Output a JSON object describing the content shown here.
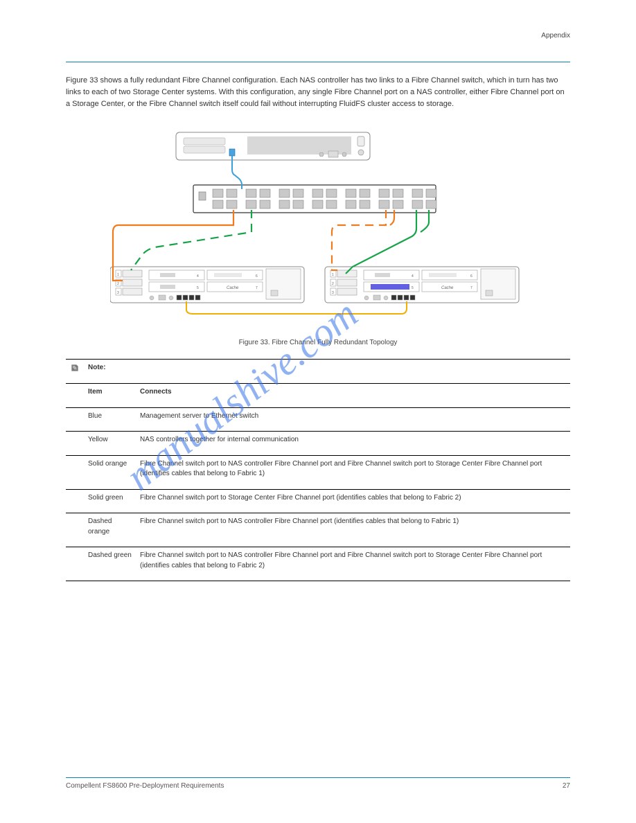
{
  "header": {
    "label": "Appendix"
  },
  "intro": "Figure 33 shows a fully redundant Fibre Channel configuration. Each NAS controller has two links to a Fibre Channel switch, which in turn has two links to each of two Storage Center systems. With this configuration, any single Fibre Channel port on a NAS controller, either Fibre Channel port on a Storage Center, or the Fibre Channel switch itself could fail without interrupting FluidFS cluster access to storage.",
  "diagram": {
    "server_label": "",
    "switch_label": "",
    "controllerA_cache": "Cache",
    "controllerB_cache": "Cache",
    "slot_labels": [
      "1",
      "2",
      "3",
      "4",
      "5",
      "6",
      "7"
    ]
  },
  "caption": "Figure 33. Fibre Channel Fully Redundant Topology",
  "table": {
    "note_label": "Note:",
    "note_text": "",
    "rows": [
      {
        "item": "Blue",
        "connects": "Management server to Ethernet switch"
      },
      {
        "item": "Yellow",
        "connects": "NAS controllers together for internal communication"
      },
      {
        "item": "Solid orange",
        "connects": "Fibre Channel switch port to NAS controller Fibre Channel port and Fibre Channel switch port to Storage Center Fibre Channel port (identifies cables that belong to Fabric 1)"
      },
      {
        "item": "Solid green",
        "connects": "Fibre Channel switch port to Storage Center Fibre Channel port (identifies cables that belong to Fabric 2)"
      },
      {
        "item": "Dashed orange",
        "connects": "Fibre Channel switch port to NAS controller Fibre Channel port (identifies cables that belong to Fabric 1)"
      },
      {
        "item": "Dashed green",
        "connects": "Fibre Channel switch port to NAS controller Fibre Channel port and Fibre Channel switch port to Storage Center Fibre Channel port (identifies cables that belong to Fabric 2)"
      }
    ]
  },
  "columns": {
    "item": "Item",
    "connects": "Connects"
  },
  "footer": {
    "left": "Compellent FS8600 Pre-Deployment Requirements",
    "right": "27"
  },
  "watermark": "manualshive.com"
}
